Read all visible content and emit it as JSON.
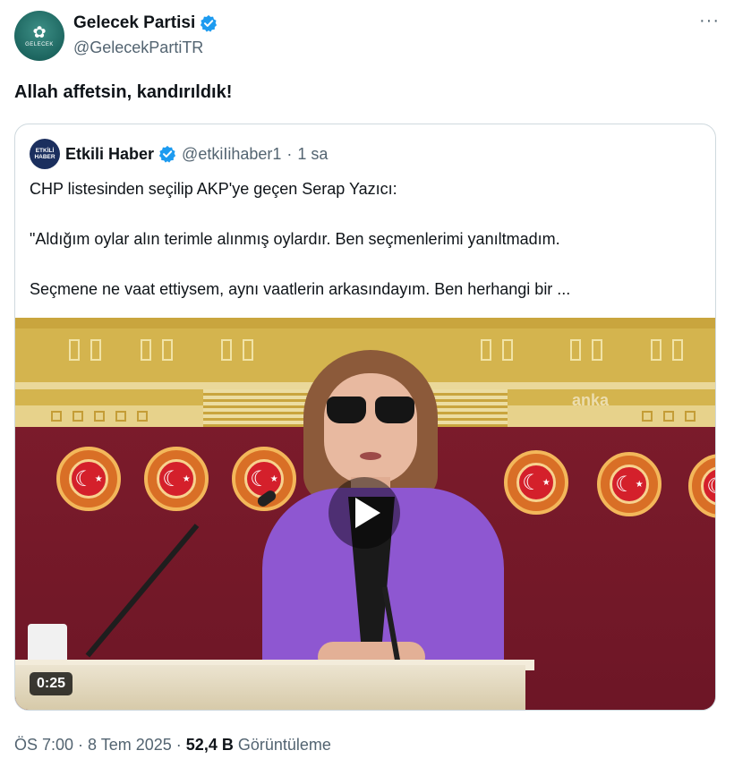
{
  "author": {
    "display_name": "Gelecek Partisi",
    "handle": "@GelecekPartiTR",
    "avatar_label": "GELECEK",
    "verified": true
  },
  "more_label": "···",
  "tweet": {
    "text": "Allah affetsin, kandırıldık!"
  },
  "quoted": {
    "avatar_label_1": "ETKİLİ",
    "avatar_label_2": "HABER",
    "display_name": "Etkili Haber",
    "handle": "@etkiIihaber1",
    "separator": "·",
    "time": "1 sa",
    "lines": [
      "CHP listesinden seçilip AKP'ye geçen Serap Yazıcı:",
      "\"Aldığım oylar alın terimle alınmış oylardır. Ben seçmenlerimi yanıltmadım.",
      "Seçmene ne vaat ettiysem, aynı vaatlerin arkasındayım. Ben herhangi bir ..."
    ],
    "video": {
      "duration": "0:25",
      "watermark": "anka"
    }
  },
  "meta": {
    "time": "ÖS 7:00",
    "separator": "·",
    "date": "8 Tem 2025",
    "views_count": "52,4 B",
    "views_label": "Görüntüleme"
  },
  "colors": {
    "verified": "#1d9bf0",
    "secondary_text": "#536471",
    "jacket": "#8e57d1",
    "wall": "#7b1b2b"
  }
}
